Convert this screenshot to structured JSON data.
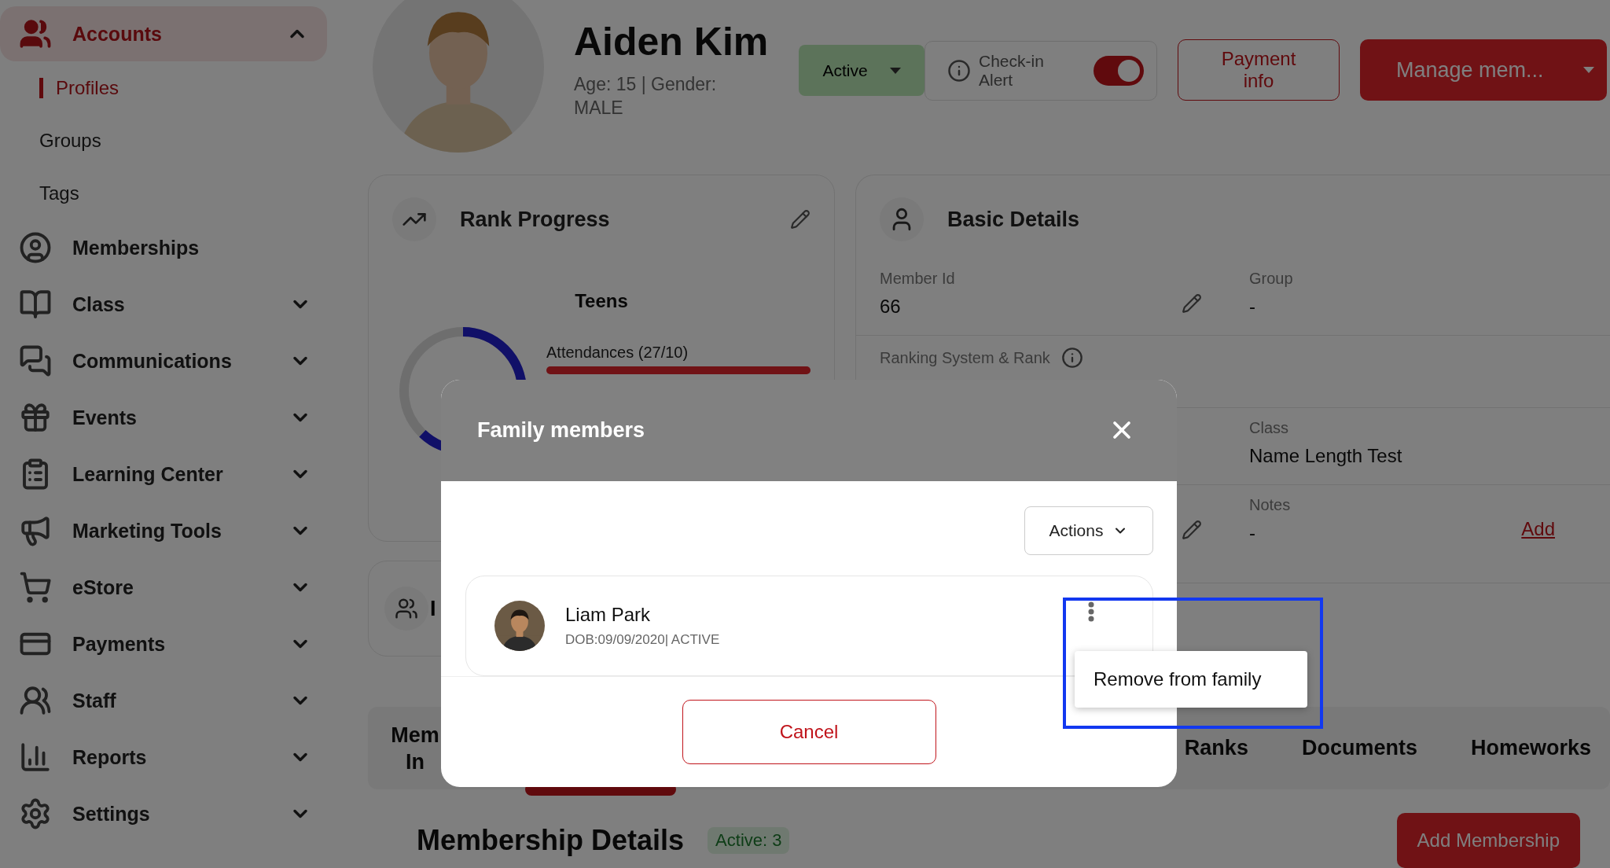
{
  "sidebar": {
    "items": [
      {
        "label": "Accounts",
        "expanded": true,
        "selected": true,
        "children": [
          {
            "label": "Profiles",
            "selected": true
          },
          {
            "label": "Groups",
            "selected": false
          },
          {
            "label": "Tags",
            "selected": false
          }
        ]
      },
      {
        "label": "Memberships",
        "selected": false
      },
      {
        "label": "Class",
        "expanded": false,
        "selected": false
      },
      {
        "label": "Communications",
        "expanded": false,
        "selected": false
      },
      {
        "label": "Events",
        "expanded": false,
        "selected": false
      },
      {
        "label": "Learning Center",
        "expanded": false,
        "selected": false
      },
      {
        "label": "Marketing Tools",
        "expanded": false,
        "selected": false
      },
      {
        "label": "eStore",
        "expanded": false,
        "selected": false
      },
      {
        "label": "Payments",
        "expanded": false,
        "selected": false
      },
      {
        "label": "Staff",
        "expanded": false,
        "selected": false
      },
      {
        "label": "Reports",
        "expanded": false,
        "selected": false
      },
      {
        "label": "Settings",
        "expanded": false,
        "selected": false
      }
    ]
  },
  "profile": {
    "name": "Aiden Kim",
    "details": "Age: 15 | Gender: MALE",
    "status": "Active",
    "checkin": {
      "label": "Check-in Alert",
      "on": true
    },
    "payment": "Payment info",
    "manage": "Manage mem..."
  },
  "rank_progress": {
    "title": "Rank Progress",
    "group": "Teens",
    "attendance": {
      "label": "Attendances (27/10)",
      "level": 1
    }
  },
  "basic_details": {
    "title": "Basic Details",
    "fields": [
      {
        "label": "Member Id",
        "value": "66",
        "editable": true
      },
      {
        "label": "Group",
        "value": "-"
      },
      {
        "label": "Ranking System & Rank",
        "info": true
      },
      {
        "label": "Class",
        "value": "Name Length Test"
      },
      {
        "label": "Notes",
        "value": "-",
        "link": "Add",
        "editable": true
      }
    ]
  },
  "family_card": {
    "title": "I"
  },
  "tabs": [
    {
      "label": "Mem In"
    },
    {
      "label": "Ranks"
    },
    {
      "label": "Documents"
    },
    {
      "label": "Homeworks"
    }
  ],
  "membership": {
    "title": "Membership Details",
    "badge": "Active: 3",
    "button": "Add Membership"
  },
  "modal": {
    "title": "Family members",
    "actions": "Actions",
    "members": [
      {
        "name": "Liam Park",
        "details": "DOB:09/09/2020| ACTIVE",
        "menu_open": true
      }
    ],
    "menu": [
      "Remove from family"
    ],
    "cancel": "Cancel"
  }
}
